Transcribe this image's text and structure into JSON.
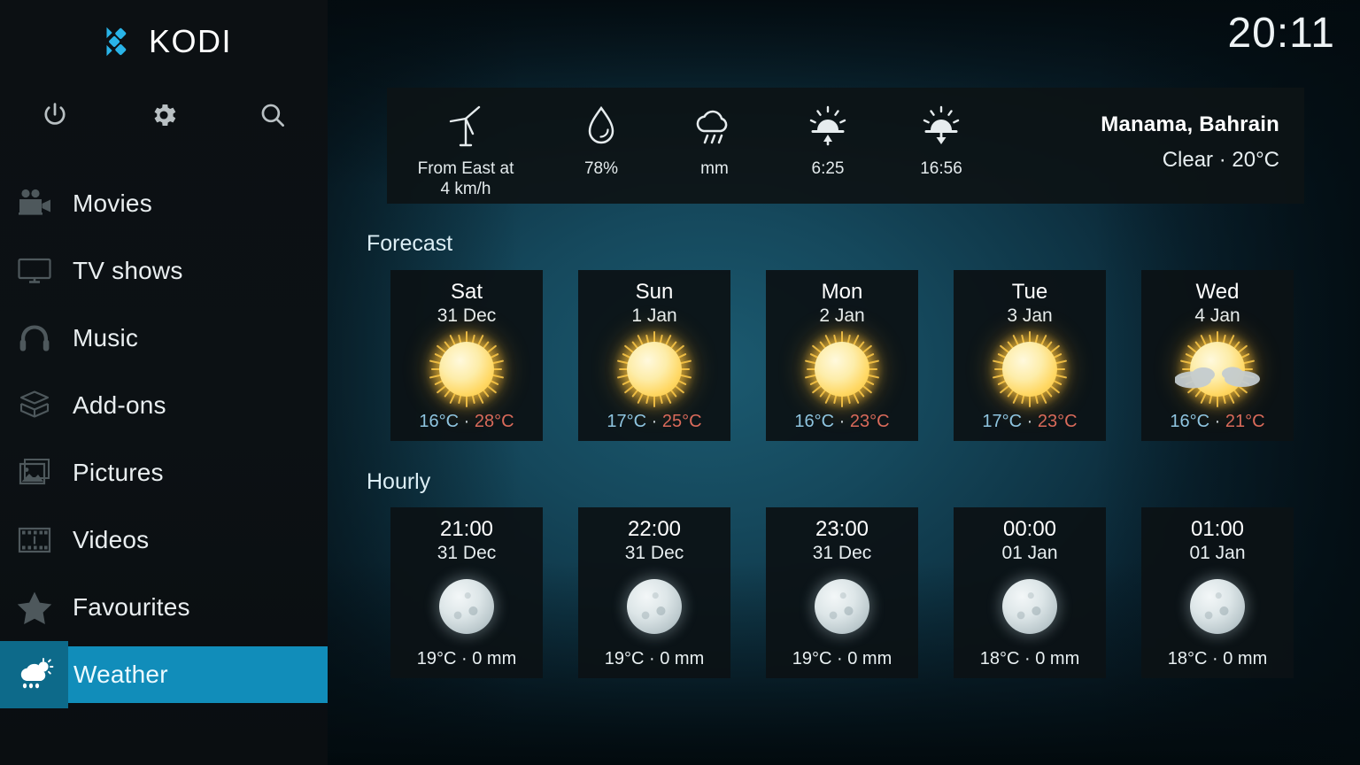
{
  "brand": {
    "name": "KODI",
    "logo_icon": "kodi-logo-icon"
  },
  "clock": {
    "time": "20:11"
  },
  "sysbar": [
    {
      "name": "power-icon",
      "label": "Power"
    },
    {
      "name": "gear-icon",
      "label": "Settings"
    },
    {
      "name": "search-icon",
      "label": "Search"
    }
  ],
  "sidebar": {
    "items": [
      {
        "label": "Movies",
        "icon": "movie-camera-icon",
        "active": false
      },
      {
        "label": "TV shows",
        "icon": "television-icon",
        "active": false
      },
      {
        "label": "Music",
        "icon": "headphones-icon",
        "active": false
      },
      {
        "label": "Add-ons",
        "icon": "package-box-icon",
        "active": false
      },
      {
        "label": "Pictures",
        "icon": "photo-stack-icon",
        "active": false
      },
      {
        "label": "Videos",
        "icon": "film-strip-icon",
        "active": false
      },
      {
        "label": "Favourites",
        "icon": "star-icon",
        "active": false
      },
      {
        "label": "Weather",
        "icon": "cloud-sun-rain-icon",
        "active": true
      }
    ]
  },
  "infobar": {
    "cells": [
      {
        "icon": "wind-turbine-icon",
        "value": "From East at\n4 km/h",
        "name": "wind"
      },
      {
        "icon": "water-drop-icon",
        "value": "78%",
        "name": "humidity"
      },
      {
        "icon": "rain-cloud-icon",
        "value": "mm",
        "name": "precipitation"
      },
      {
        "icon": "sunrise-icon",
        "value": "6:25",
        "name": "sunrise"
      },
      {
        "icon": "sunset-icon",
        "value": "16:56",
        "name": "sunset"
      }
    ],
    "location": "Manama, Bahrain",
    "condition": "Clear · 20°C"
  },
  "sections": {
    "forecast_title": "Forecast",
    "hourly_title": "Hourly"
  },
  "forecast": [
    {
      "day": "Sat",
      "date": "31 Dec",
      "icon": "sun-icon",
      "low": "16°C",
      "sep": "·",
      "high": "28°C"
    },
    {
      "day": "Sun",
      "date": "1 Jan",
      "icon": "sun-icon",
      "low": "17°C",
      "sep": "·",
      "high": "25°C"
    },
    {
      "day": "Mon",
      "date": "2 Jan",
      "icon": "sun-icon",
      "low": "16°C",
      "sep": "·",
      "high": "23°C"
    },
    {
      "day": "Tue",
      "date": "3 Jan",
      "icon": "sun-icon",
      "low": "17°C",
      "sep": "·",
      "high": "23°C"
    },
    {
      "day": "Wed",
      "date": "4 Jan",
      "icon": "sun-cloud-icon",
      "low": "16°C",
      "sep": "·",
      "high": "21°C"
    }
  ],
  "hourly": [
    {
      "time": "21:00",
      "date": "31 Dec",
      "icon": "moon-icon",
      "readout": "19°C · 0 mm"
    },
    {
      "time": "22:00",
      "date": "31 Dec",
      "icon": "moon-icon",
      "readout": "19°C · 0 mm"
    },
    {
      "time": "23:00",
      "date": "31 Dec",
      "icon": "moon-icon",
      "readout": "19°C · 0 mm"
    },
    {
      "time": "00:00",
      "date": "01 Jan",
      "icon": "moon-icon",
      "readout": "18°C · 0 mm"
    },
    {
      "time": "01:00",
      "date": "01 Jan",
      "icon": "moon-icon",
      "readout": "18°C · 0 mm"
    }
  ],
  "colors": {
    "accent": "#118dba",
    "accent_dark": "#0d6a8a",
    "temp_low": "#8fc5e0",
    "temp_high": "#d96a5a",
    "card_bg": "#0c1215",
    "sidebar_bg": "#0c1114"
  }
}
